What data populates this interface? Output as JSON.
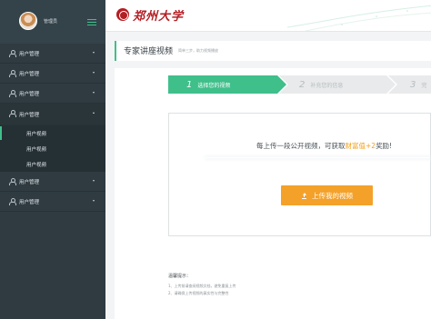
{
  "sidebar": {
    "username": "管理员",
    "items": [
      {
        "label": "用户管理"
      },
      {
        "label": "用户管理"
      },
      {
        "label": "用户管理"
      },
      {
        "label": "用户管理"
      },
      {
        "label": "用户管理"
      },
      {
        "label": "用户管理"
      }
    ],
    "subitems": [
      {
        "label": "用户视频"
      },
      {
        "label": "用户视频"
      },
      {
        "label": "用户视频"
      }
    ]
  },
  "header": {
    "logo_text": "郑州大学"
  },
  "page": {
    "title": "专家讲座视频",
    "subtitle": "简单三步，助力视频播放"
  },
  "steps": [
    {
      "num": "1",
      "label": "选择您的视频"
    },
    {
      "num": "2",
      "label": "补充您的信息"
    },
    {
      "num": "3",
      "label": "完"
    }
  ],
  "upload": {
    "message_pre": "每上传一段公开视频，可获取",
    "message_highlight": "财富值+2",
    "message_post": "奖励!",
    "button_label": "上传我的视频"
  },
  "tips": {
    "title": "温馨提示：",
    "items": [
      "1、上传前请查阅视频文档，避免重复上传",
      "2、请确保上传视频的真实性与完整性"
    ]
  },
  "colors": {
    "accent": "#3fbf8a",
    "sidebar": "#2f3b41",
    "button": "#f4a12a",
    "highlight": "#f39c12",
    "brand": "#b31e24"
  }
}
